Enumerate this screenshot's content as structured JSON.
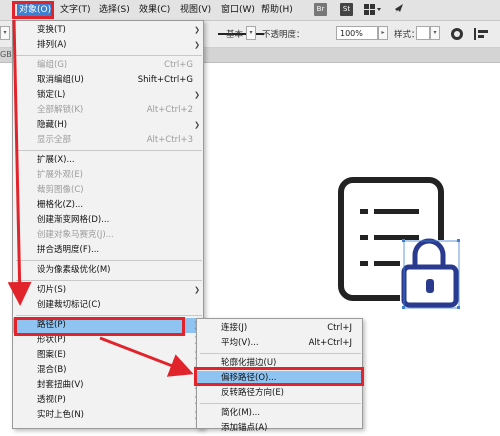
{
  "menubar": {
    "items": [
      "对象(O)",
      "文字(T)",
      "选择(S)",
      "效果(C)",
      "视图(V)",
      "窗口(W)",
      "帮助(H)"
    ],
    "icons": {
      "br": "Br",
      "st": "St"
    }
  },
  "ctrlbar": {
    "stroke_label": "基本",
    "opacity_label": "不透明度：",
    "opacity_value": "100%",
    "style_label": "样式："
  },
  "tabstrip": {
    "mode": "GB"
  },
  "object_menu": [
    {
      "label": "变换(T)",
      "arrow": true
    },
    {
      "label": "排列(A)",
      "arrow": true
    },
    {
      "sep": true
    },
    {
      "label": "编组(G)",
      "shortcut": "Ctrl+G",
      "disabled": true
    },
    {
      "label": "取消编组(U)",
      "shortcut": "Shift+Ctrl+G"
    },
    {
      "label": "锁定(L)",
      "arrow": true
    },
    {
      "label": "全部解锁(K)",
      "shortcut": "Alt+Ctrl+2",
      "disabled": true
    },
    {
      "label": "隐藏(H)",
      "arrow": true
    },
    {
      "label": "显示全部",
      "shortcut": "Alt+Ctrl+3",
      "disabled": true
    },
    {
      "sep": true
    },
    {
      "label": "扩展(X)..."
    },
    {
      "label": "扩展外观(E)",
      "disabled": true
    },
    {
      "label": "裁剪图像(C)",
      "disabled": true
    },
    {
      "label": "栅格化(Z)..."
    },
    {
      "label": "创建渐变网格(D)..."
    },
    {
      "label": "创建对象马赛克(J)...",
      "disabled": true
    },
    {
      "label": "拼合透明度(F)..."
    },
    {
      "sep": true
    },
    {
      "label": "设为像素级优化(M)"
    },
    {
      "sep": true
    },
    {
      "label": "切片(S)",
      "arrow": true
    },
    {
      "label": "创建裁切标记(C)"
    },
    {
      "sep": true
    },
    {
      "label": "路径(P)",
      "arrow": true,
      "highlighted": true
    },
    {
      "label": "形状(P)",
      "arrow": true
    },
    {
      "label": "图案(E)",
      "arrow": true
    },
    {
      "label": "混合(B)",
      "arrow": true
    },
    {
      "label": "封套扭曲(V)",
      "arrow": true
    },
    {
      "label": "透视(P)",
      "arrow": true
    },
    {
      "label": "实时上色(N)",
      "arrow": true
    }
  ],
  "path_submenu": [
    {
      "label": "连接(J)",
      "shortcut": "Ctrl+J"
    },
    {
      "label": "平均(V)...",
      "shortcut": "Alt+Ctrl+J"
    },
    {
      "sep": true
    },
    {
      "label": "轮廓化描边(U)"
    },
    {
      "label": "偏移路径(O)...",
      "highlighted": true
    },
    {
      "label": "反转路径方向(E)"
    },
    {
      "sep": true
    },
    {
      "label": "简化(M)..."
    },
    {
      "label": "添加锚点(A)"
    }
  ],
  "annotation_color": "#e1242b",
  "highlight_color": "#8fc3f1"
}
